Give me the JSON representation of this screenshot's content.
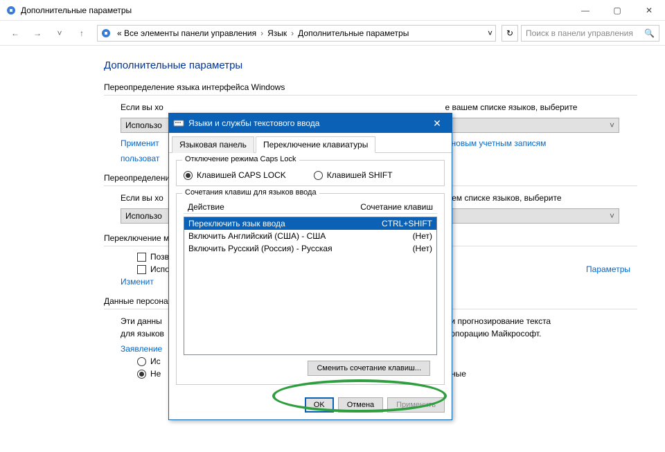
{
  "window": {
    "title": "Дополнительные параметры",
    "controls": {
      "min": "—",
      "max": "▢",
      "close": "✕"
    }
  },
  "nav": {
    "back": "←",
    "forward": "→",
    "dropdown": "˅",
    "up": "↑",
    "crumb_root": "« Все элементы панели управления",
    "crumb_lang": "Язык",
    "crumb_current": "Дополнительные параметры",
    "sep": "›",
    "addr_dropdown": "˅",
    "refresh": "↻",
    "search_placeholder": "Поиск в панели управления",
    "search_icon": "🔍"
  },
  "page": {
    "title": "Дополнительные параметры",
    "sec1": {
      "header": "Переопределение языка интерфейса Windows",
      "para_before": "Если вы хо",
      "para_after": "е вашем списке языков, выберите",
      "combo": "Использо",
      "link1_before": "Применит",
      "link1_after": "и и новым учетным записям",
      "link2": "пользоват"
    },
    "sec2": {
      "header": "Переопределение",
      "para_before": "Если вы хо",
      "para_after": "шем списке языков, выберите",
      "combo": "Использо"
    },
    "sec3": {
      "header": "Переключение м",
      "cb1": "Позвол",
      "cb2": "Исполь",
      "link": "Изменит",
      "right_link": "Параметры"
    },
    "sec4": {
      "header": "Данные персонал",
      "para_before": "Эти данны",
      "para_mid": "а и прогнозирование текста",
      "para2_before": "для языков",
      "para2_after": "орпорацию Майкрософт.",
      "link": "Заявление",
      "radio1": "Ис",
      "radio2": "Не",
      "radio2_after": "нные"
    }
  },
  "modal": {
    "title": "Языки и службы текстового ввода",
    "close": "✕",
    "tab1": "Языковая панель",
    "tab2": "Переключение клавиатуры",
    "group1": {
      "legend": "Отключение режима Caps Lock",
      "radio1": "Клавишей CAPS LOCK",
      "radio2": "Клавишей SHIFT"
    },
    "group2": {
      "legend": "Сочетания клавиш для языков ввода",
      "col1": "Действие",
      "col2": "Сочетание клавиш",
      "rows": [
        {
          "action": "Переключить язык ввода",
          "key": "CTRL+SHIFT"
        },
        {
          "action": "Включить Английский (США) - США",
          "key": "(Нет)"
        },
        {
          "action": "Включить Русский (Россия) - Русская",
          "key": "(Нет)"
        }
      ],
      "change_btn": "Сменить сочетание клавиш..."
    },
    "footer": {
      "ok": "OK",
      "cancel": "Отмена",
      "apply": "Применить"
    }
  }
}
